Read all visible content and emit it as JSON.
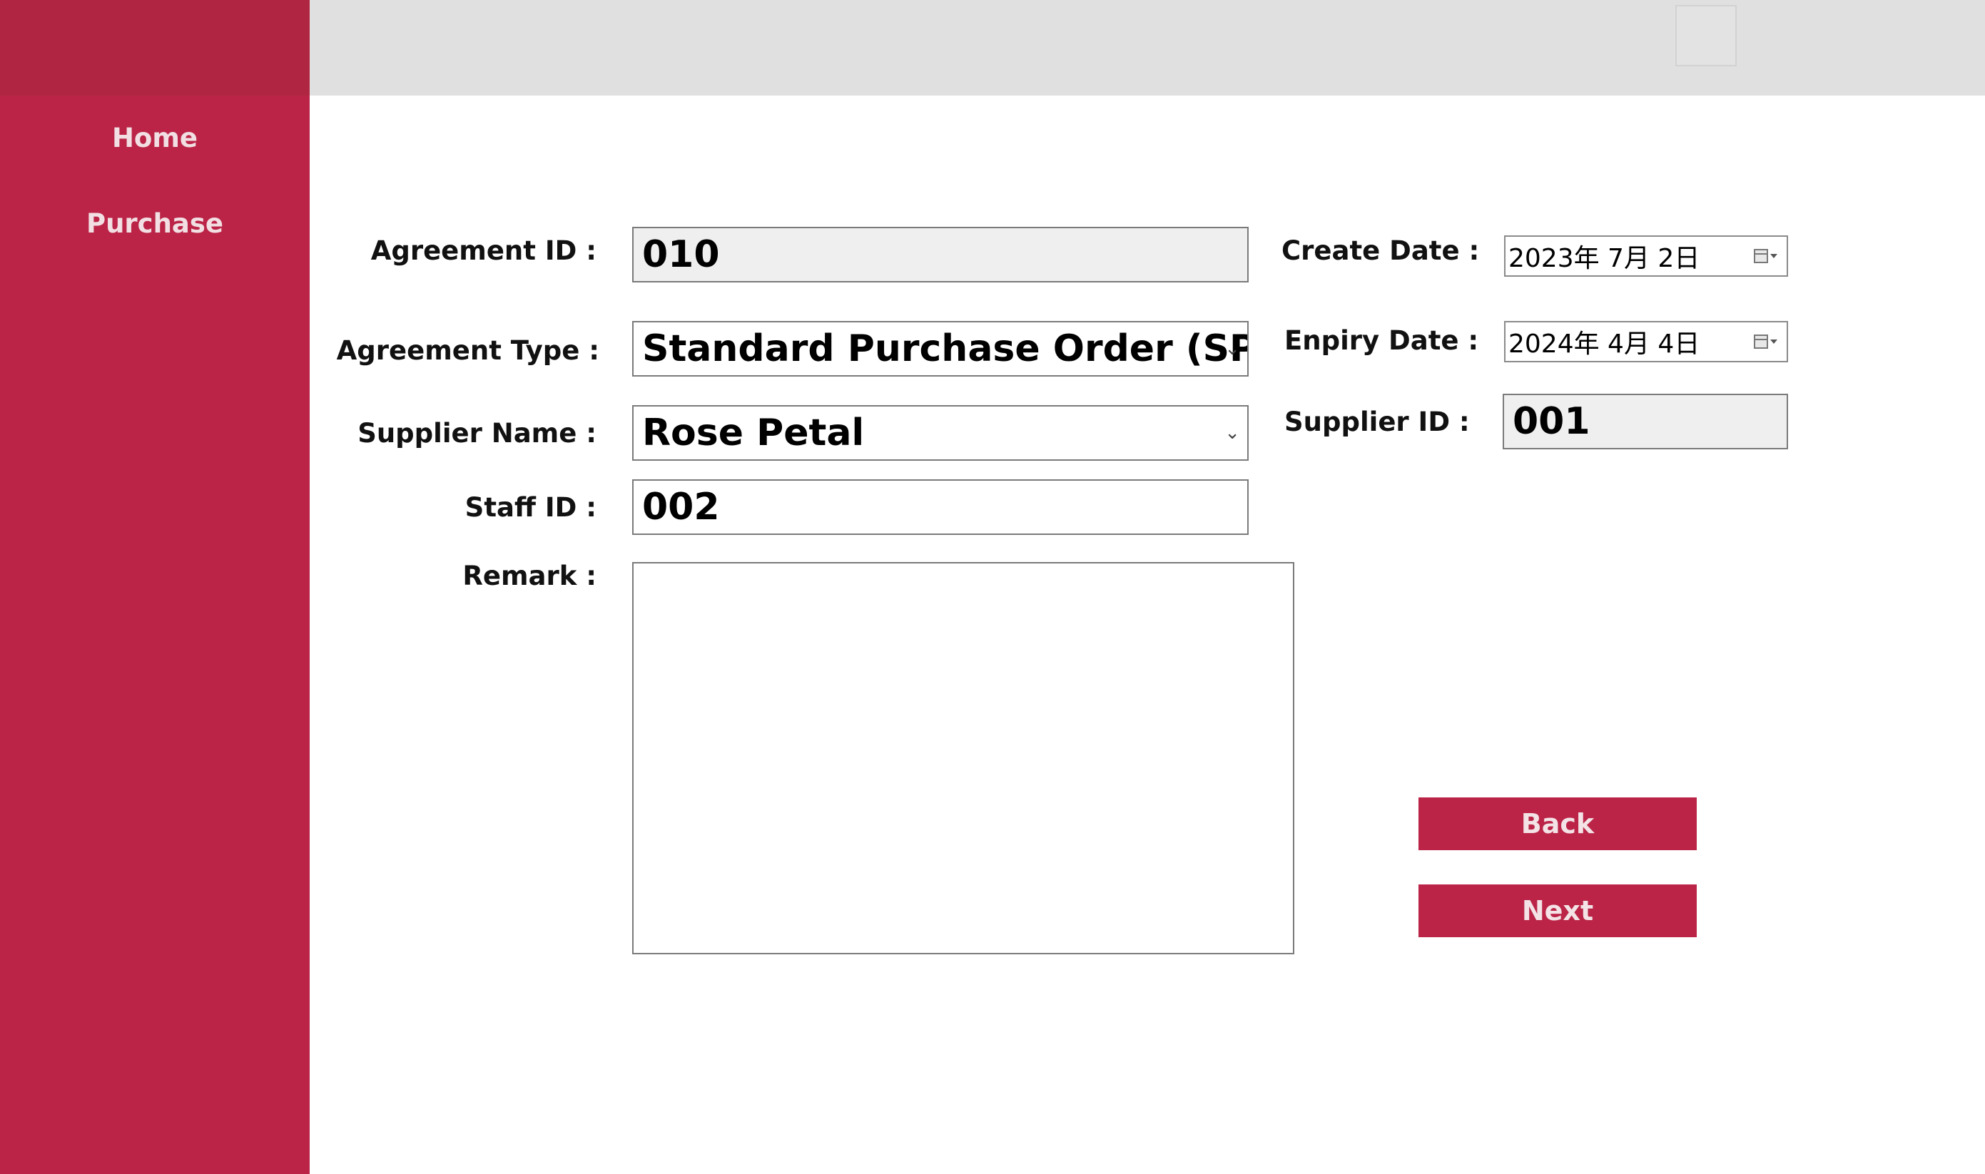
{
  "sidebar": {
    "items": [
      {
        "label": "Home"
      },
      {
        "label": "Purchase"
      }
    ]
  },
  "form": {
    "agreement_id": {
      "label": "Agreement ID :",
      "value": "010"
    },
    "agreement_type": {
      "label": "Agreement Type :",
      "value": "Standard Purchase Order (SPO"
    },
    "supplier_name": {
      "label": "Supplier Name :",
      "value": "Rose Petal"
    },
    "staff_id": {
      "label": "Staff ID :",
      "value": "002"
    },
    "remark": {
      "label": "Remark :",
      "value": ""
    },
    "create_date": {
      "label": "Create Date :",
      "value": "2023年  7月  2日"
    },
    "expiry_date": {
      "label": "Enpiry Date :",
      "value": "2024年  4月  4日"
    },
    "supplier_id": {
      "label": "Supplier ID :",
      "value": "001"
    }
  },
  "buttons": {
    "back": "Back",
    "next": "Next"
  },
  "icons": {
    "combo_arrow": "chevron-down-icon",
    "date_picker": "calendar-icon"
  },
  "colors": {
    "accent": "#bb2447",
    "header": "#e0e0e0"
  }
}
